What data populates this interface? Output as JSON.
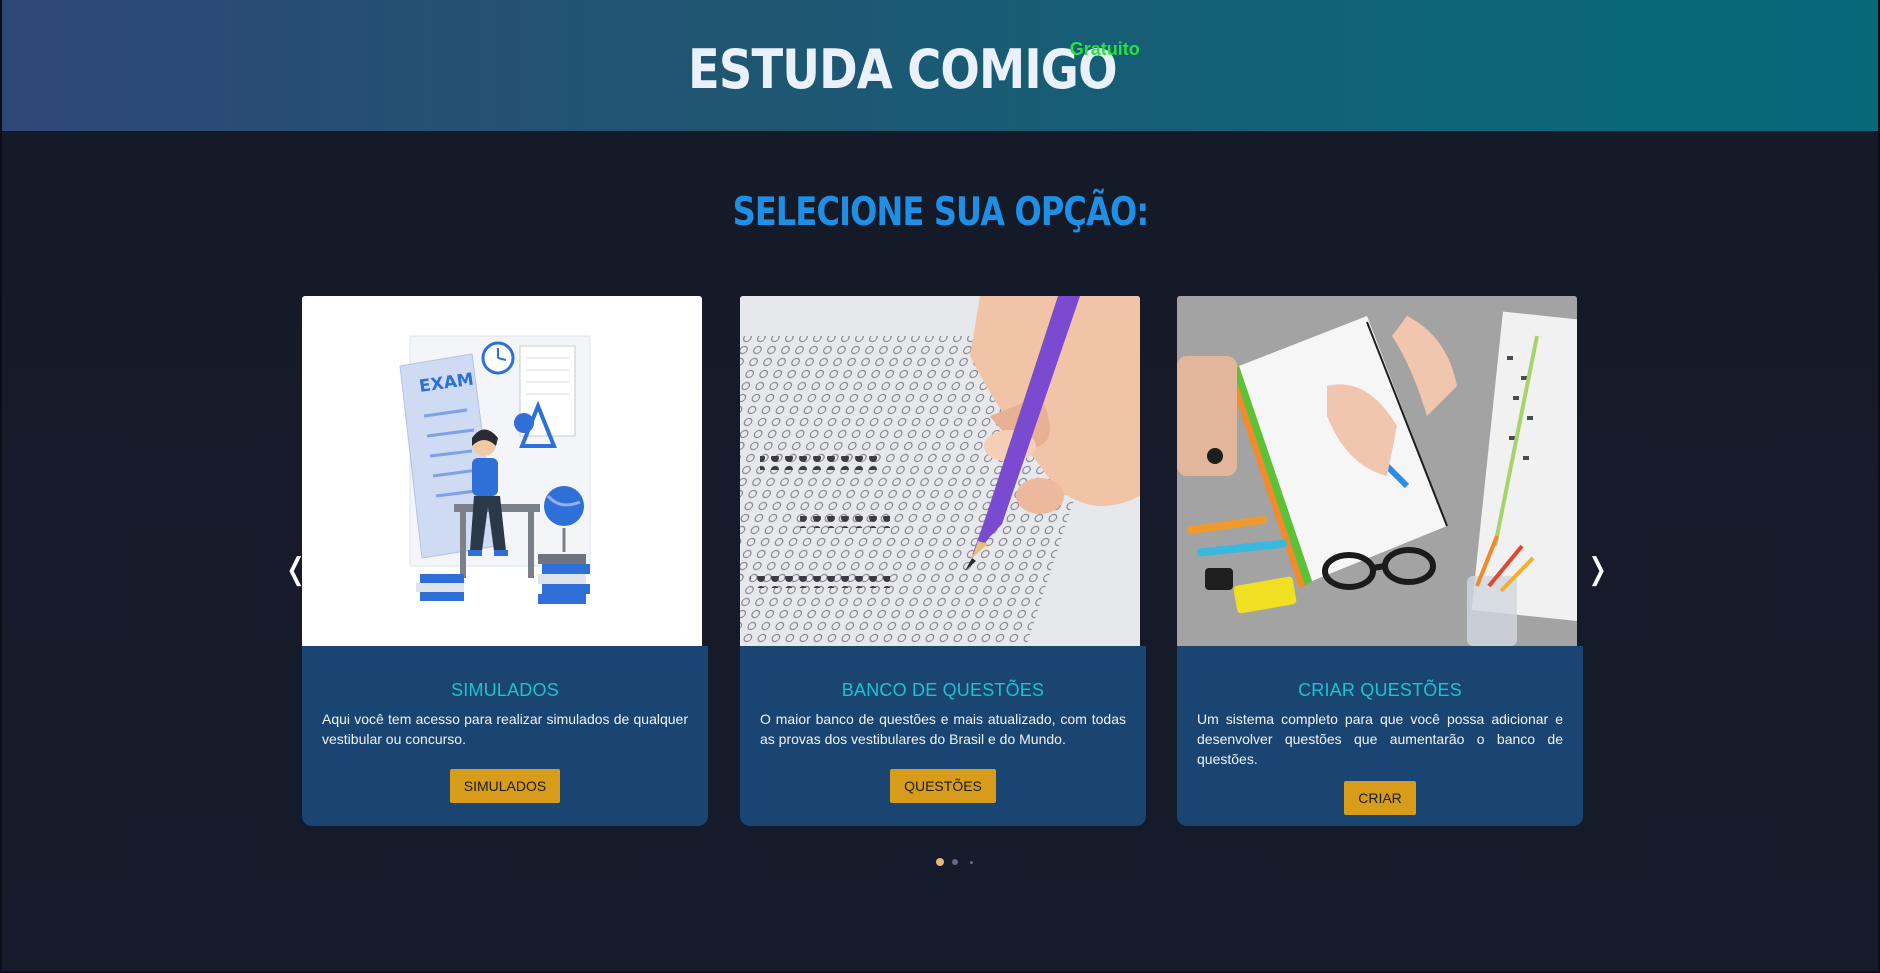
{
  "header": {
    "title": "ESTUDA COMIGO",
    "badge": "Gratuito"
  },
  "section_title": "SELECIONE SUA OPÇÃO:",
  "carousel": {
    "prev_label": "❬",
    "next_label": "❭",
    "cards": [
      {
        "title": "SIMULADOS",
        "description": "Aqui você tem acesso para realizar simulados de qualquer vestibular ou concurso.",
        "button": "SIMULADOS",
        "image_text": "EXAM"
      },
      {
        "title": "BANCO DE QUESTÕES",
        "description": "O maior banco de questões e mais atualizado, com todas as provas dos vestibulares do Brasil e do Mundo.",
        "button": "QUESTÕES"
      },
      {
        "title": "CRIAR QUESTÕES",
        "description": "Um sistema completo para que você possa adicionar e desenvolver questões que aumentarão o banco de questões.",
        "button": "CRIAR"
      }
    ],
    "pagination": {
      "current": 1,
      "total": 3
    }
  },
  "colors": {
    "accent_blue": "#1f8fe6",
    "card_title": "#1dc2cf",
    "button": "#d79c19",
    "badge_green": "#27e33c"
  }
}
